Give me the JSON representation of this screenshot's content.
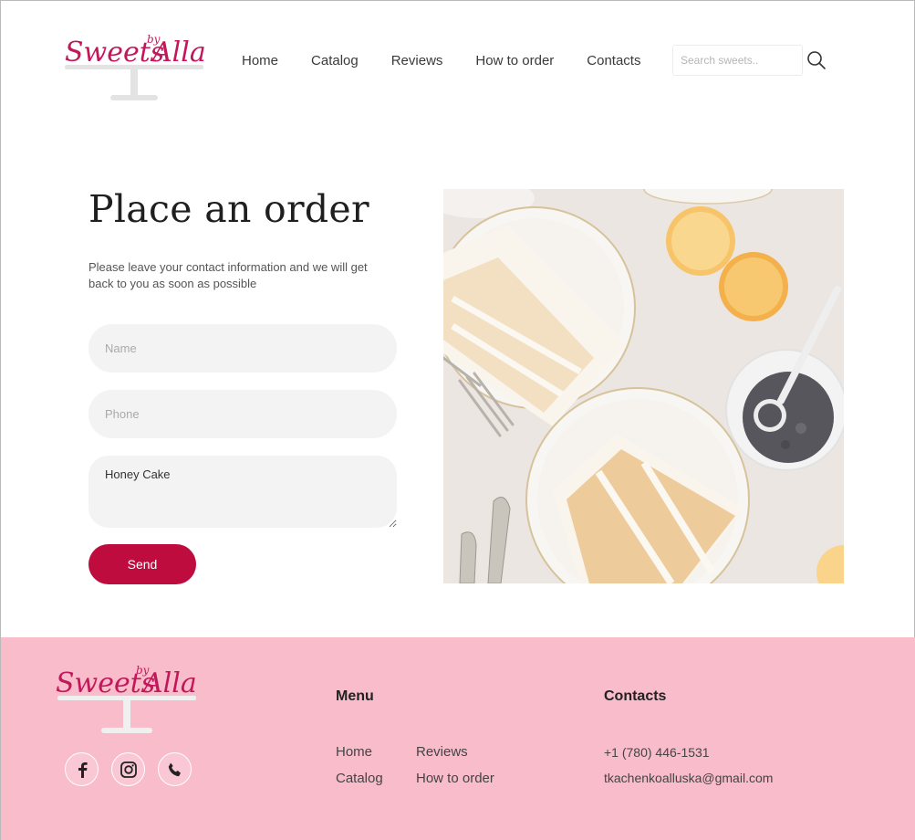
{
  "brand": {
    "logo_text": "Sweets by Alla",
    "accent": "#c2185b"
  },
  "nav": {
    "items": [
      "Home",
      "Catalog",
      "Reviews",
      "How to order",
      "Contacts"
    ]
  },
  "search": {
    "placeholder": "Search sweets..",
    "icon": "search-icon"
  },
  "order": {
    "title": "Place an order",
    "subtitle": "Please leave your contact information and we will get back to you as soon as possible",
    "name_placeholder": "Name",
    "phone_placeholder": "Phone",
    "message_value": "Honey Cake",
    "send_label": "Send",
    "send_color": "#bf0c3f"
  },
  "footer": {
    "background": "#f8bccb",
    "menu_heading": "Menu",
    "menu_items": [
      "Home",
      "Reviews",
      "Catalog",
      "How to order"
    ],
    "contacts_heading": "Contacts",
    "phone": "+1 (780) 446-1531",
    "email": "tkachenkoalluska@gmail.com",
    "socials": [
      "facebook-icon",
      "instagram-icon",
      "phone-icon"
    ]
  }
}
